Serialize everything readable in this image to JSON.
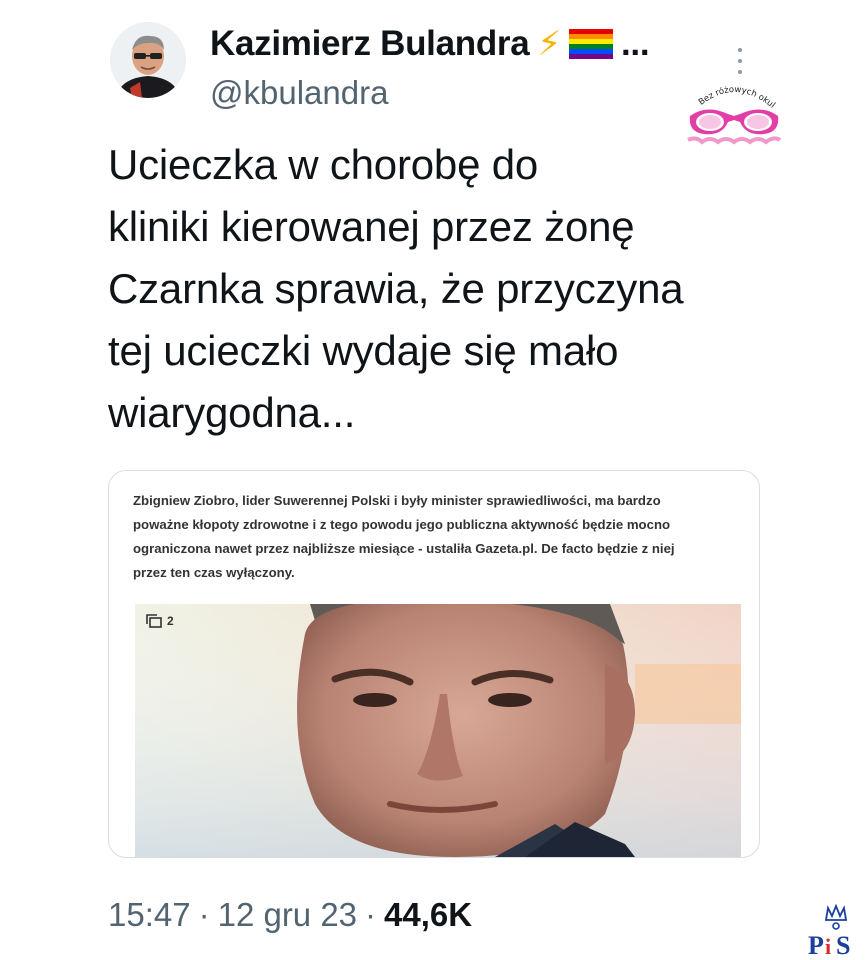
{
  "author": {
    "display_name": "Kazimierz Bulandra",
    "emoji_1": "⚡",
    "truncation": "...",
    "handle": "@kbulandra"
  },
  "watermark": {
    "text": "Bez różowych okularów"
  },
  "tweet": {
    "lines": [
      "Ucieczka w chorobę do",
      "kliniki kierowanej przez żonę",
      "Czarnka sprawia, że przyczyna",
      "tej ucieczki wydaje się mało",
      "wiarygodna..."
    ]
  },
  "media": {
    "article_lines": [
      "Zbigniew Ziobro, lider Suwerennej Polski i były minister sprawiedliwości, ma bardzo",
      "poważne kłopoty zdrowotne i z tego powodu jego publiczna aktywność będzie mocno",
      "ograniczona nawet przez najbliższe miesiące - ustaliła Gazeta.pl. De facto będzie z niej",
      "przez ten czas wyłączony."
    ],
    "gallery_count": "2"
  },
  "footer": {
    "time": "15:47",
    "separator": "·",
    "date": "12 gru 23",
    "views": "44,6K"
  },
  "logo": {
    "text": "PiS"
  }
}
